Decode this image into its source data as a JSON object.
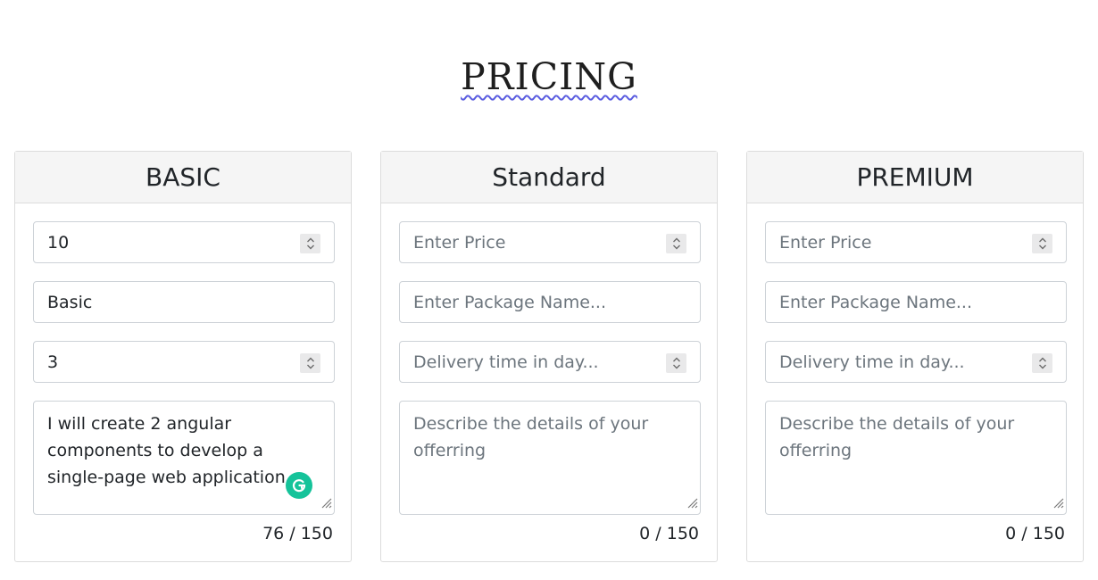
{
  "page": {
    "title": "PRICING"
  },
  "packages": [
    {
      "header": "BASIC",
      "price": {
        "value": "10",
        "placeholder": "Enter Price"
      },
      "name": {
        "value": "Basic",
        "placeholder": "Enter Package Name..."
      },
      "delivery": {
        "value": "3",
        "placeholder": "Delivery time in day..."
      },
      "description": {
        "value": "I will create 2 angular components to develop a single-page web application.",
        "placeholder": "Describe the details of your offerring"
      },
      "counter": "76 / 150",
      "show_grammarly": true
    },
    {
      "header": "Standard",
      "price": {
        "value": "",
        "placeholder": "Enter Price"
      },
      "name": {
        "value": "",
        "placeholder": "Enter Package Name..."
      },
      "delivery": {
        "value": "",
        "placeholder": "Delivery time in day..."
      },
      "description": {
        "value": "",
        "placeholder": "Describe the details of your offerring"
      },
      "counter": "0 / 150",
      "show_grammarly": false
    },
    {
      "header": "PREMIUM",
      "price": {
        "value": "",
        "placeholder": "Enter Price"
      },
      "name": {
        "value": "",
        "placeholder": "Enter Package Name..."
      },
      "delivery": {
        "value": "",
        "placeholder": "Delivery time in day..."
      },
      "description": {
        "value": "",
        "placeholder": "Describe the details of your offerring"
      },
      "counter": "0 / 150",
      "show_grammarly": false
    }
  ],
  "colors": {
    "grammarly": "#15c39a",
    "spellcheck_underline": "#5a5ce0",
    "card_header_bg": "#f5f5f5"
  },
  "icons": {
    "spinner": "up-down-spinner-icon",
    "grip": "resize-grip-icon",
    "grammarly": "grammarly-icon"
  }
}
